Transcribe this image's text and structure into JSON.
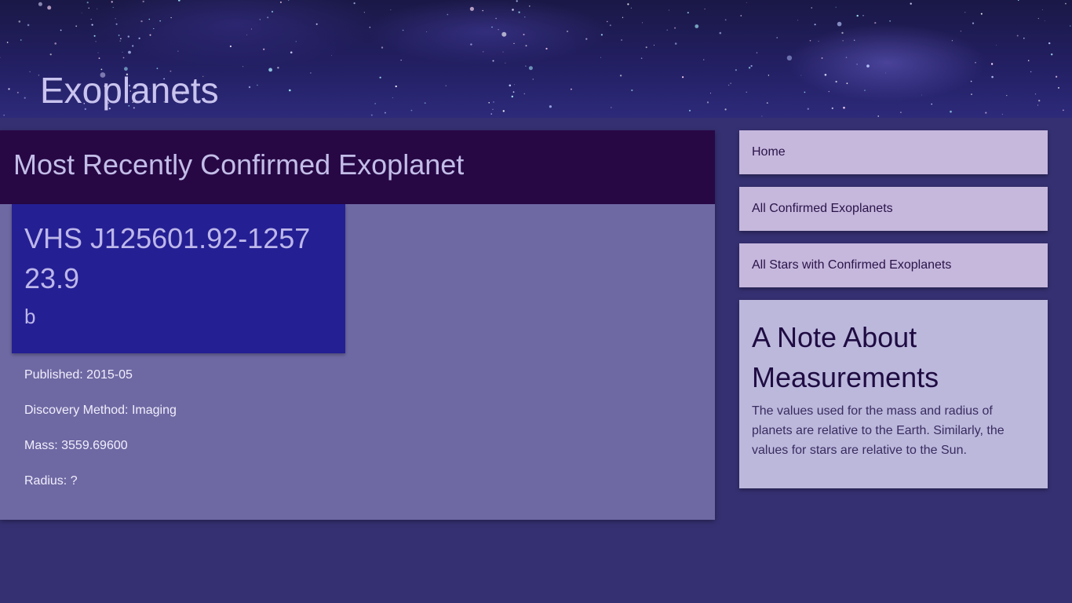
{
  "site": {
    "title": "Exoplanets"
  },
  "main": {
    "heading": "Most Recently Confirmed Exoplanet",
    "planet": {
      "host_name": "VHS J125601.92-125723.9",
      "letter": "b"
    },
    "facts": {
      "published": "Published: 2015-05",
      "discovery_method": "Discovery Method: Imaging",
      "mass": "Mass: 3559.69600",
      "radius": "Radius: ?"
    }
  },
  "nav": {
    "items": [
      {
        "label": "Home"
      },
      {
        "label": "All Confirmed Exoplanets"
      },
      {
        "label": "All Stars with Confirmed Exoplanets"
      }
    ]
  },
  "note": {
    "title": "A Note About Measurements",
    "body": "The values used for the mass and radius of planets are relative to the Earth. Similarly, the values for stars are relative to the Sun."
  },
  "colors": {
    "page_background": "#353071",
    "heading_bar": "#270845",
    "card_background": "#6e69a3",
    "planet_box": "#241f93",
    "nav_item": "#c6b7dd",
    "note_card": "#bbb8dc"
  }
}
